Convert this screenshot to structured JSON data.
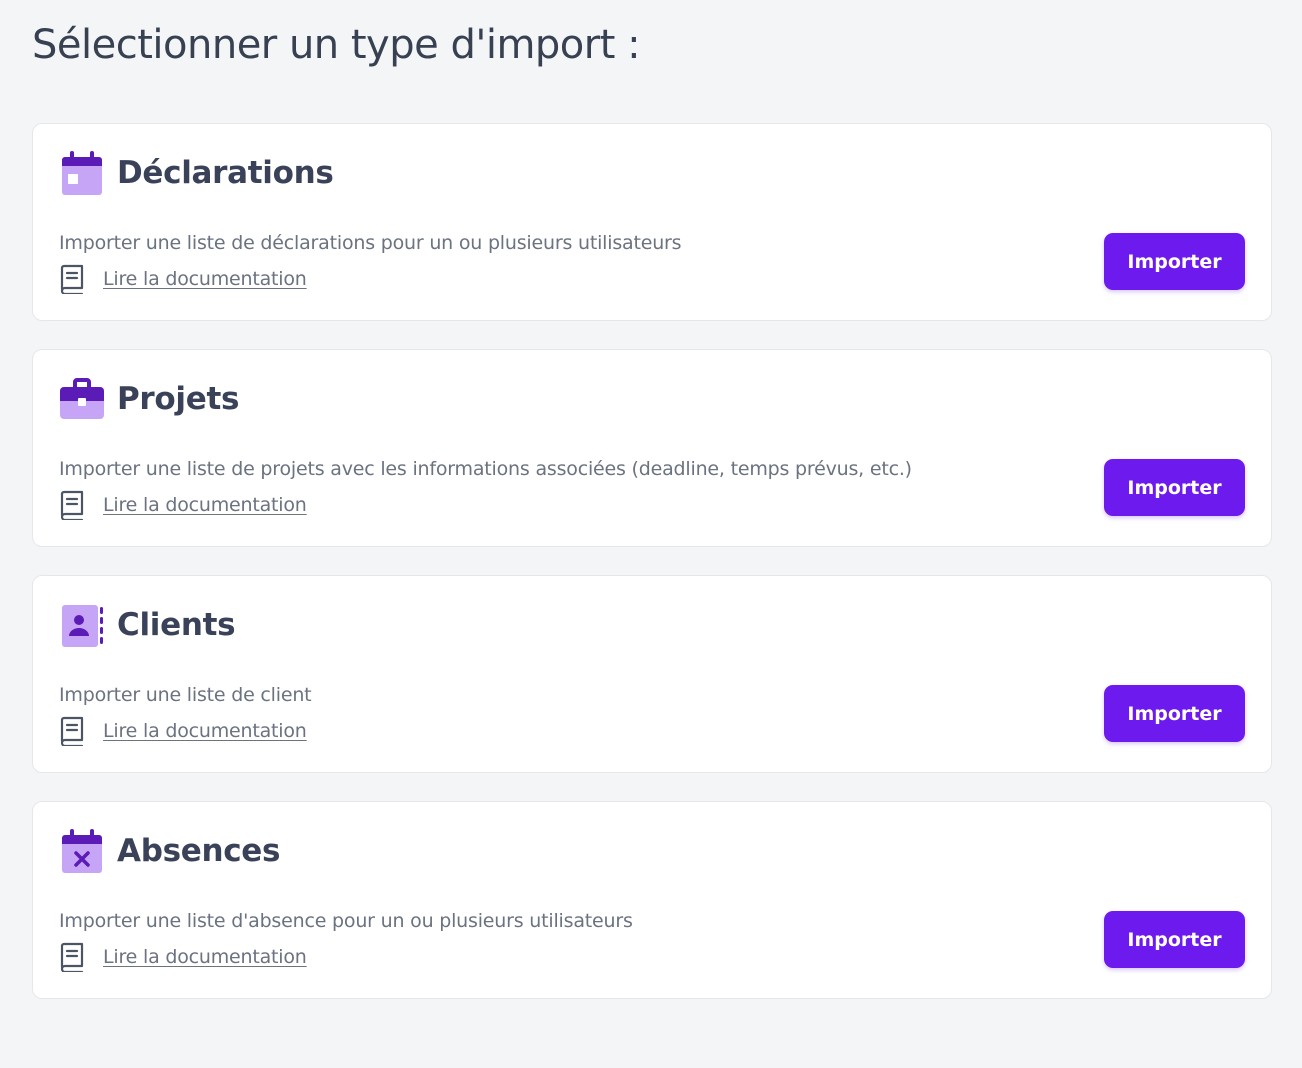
{
  "page": {
    "title": "Sélectionner un type d'import :"
  },
  "colors": {
    "accent": "#6d1aee",
    "icon_light": "#c6a5f7",
    "icon_dark": "#5b1bb6",
    "background": "#f4f5f7"
  },
  "cards": [
    {
      "icon": "calendar-icon",
      "title": "Déclarations",
      "description": "Importer une liste de déclarations pour un ou plusieurs utilisateurs",
      "doc_link": "Lire la documentation",
      "button": "Importer"
    },
    {
      "icon": "briefcase-icon",
      "title": "Projets",
      "description": "Importer une liste de projets avec les informations associées (deadline, temps prévus, etc.)",
      "doc_link": "Lire la documentation",
      "button": "Importer"
    },
    {
      "icon": "contact-book-icon",
      "title": "Clients",
      "description": "Importer une liste de client",
      "doc_link": "Lire la documentation",
      "button": "Importer"
    },
    {
      "icon": "calendar-x-icon",
      "title": "Absences",
      "description": "Importer une liste d'absence pour un ou plusieurs utilisateurs",
      "doc_link": "Lire la documentation",
      "button": "Importer"
    }
  ]
}
